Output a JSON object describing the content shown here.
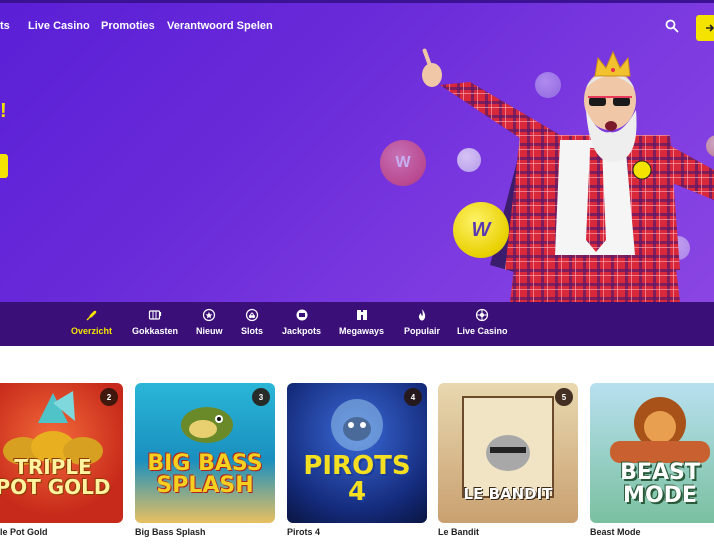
{
  "nav": {
    "items": [
      "ts",
      "Live Casino",
      "Promoties",
      "Verantwoord Spelen"
    ]
  },
  "hero": {
    "headline_fragment": "!",
    "coin_logo": "W"
  },
  "categories": [
    {
      "label": "Overzicht",
      "icon": "rocket-icon",
      "active": true
    },
    {
      "label": "Gokkasten",
      "icon": "slot-machine-icon",
      "active": false
    },
    {
      "label": "Nieuw",
      "icon": "star-badge-icon",
      "active": false
    },
    {
      "label": "Slots",
      "icon": "cherry-chip-icon",
      "active": false
    },
    {
      "label": "Jackpots",
      "icon": "jackpot-chip-icon",
      "active": false
    },
    {
      "label": "Megaways",
      "icon": "megaways-icon",
      "active": false
    },
    {
      "label": "Populair",
      "icon": "flame-icon",
      "active": false
    },
    {
      "label": "Live Casino",
      "icon": "roulette-icon",
      "active": false
    }
  ],
  "games": [
    {
      "rank": "2",
      "name": "le Pot Gold",
      "art_title": "TRIPLE POT GOLD",
      "accent": "#e23b2a"
    },
    {
      "rank": "3",
      "name": "Big Bass Splash",
      "art_title": "BIG BASS SPLASH",
      "accent": "#1fa2c9"
    },
    {
      "rank": "4",
      "name": "Pirots 4",
      "art_title": "PIROTS 4",
      "accent": "#1a3a9c"
    },
    {
      "rank": "5",
      "name": "Le Bandit",
      "art_title": "LE BANDIT",
      "accent": "#c9a070"
    },
    {
      "rank": "",
      "name": "Beast Mode",
      "art_title": "BEAST MODE",
      "accent": "#3a9a5a"
    }
  ],
  "colors": {
    "brand_purple": "#6a2bd9",
    "category_bar": "#3a1078",
    "accent_yellow": "#f4e300"
  }
}
